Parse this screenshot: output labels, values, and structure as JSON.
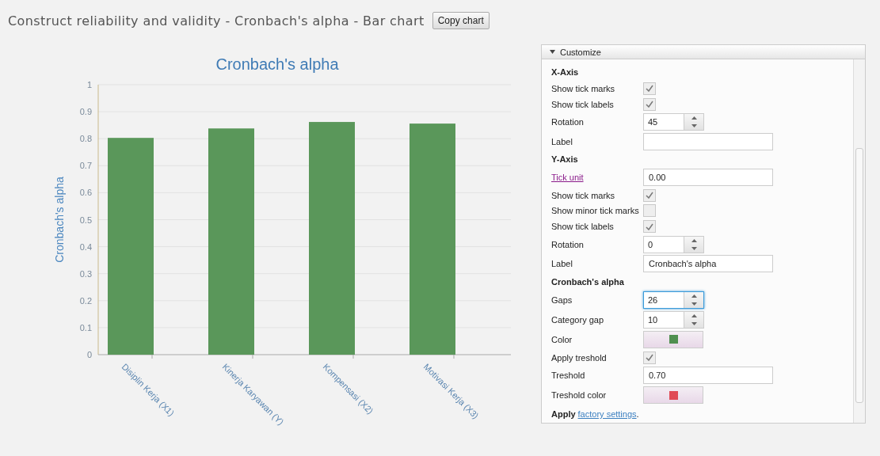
{
  "title": "Construct reliability and validity - Cronbach's alpha - Bar chart",
  "copy_button": "Copy chart",
  "chart_data": {
    "type": "bar",
    "title": "Cronbach's alpha",
    "ylabel": "Cronbach's alpha",
    "categories": [
      "Disiplin Kerja (X1)",
      "Kinerja Karyawan (Y)",
      "Kompensasi (X2)",
      "Motivasi Kerja (X3)"
    ],
    "grid": true,
    "series": [
      {
        "color": "#5a975a",
        "values": [
          0.803,
          0.838,
          0.862,
          0.856
        ]
      }
    ],
    "ylim": [
      0,
      1
    ],
    "yticks": [
      0,
      0.1,
      0.2,
      0.3,
      0.4,
      0.5,
      0.6,
      0.7,
      0.8,
      0.9,
      1
    ]
  },
  "customize": {
    "title": "Customize",
    "expanded": true,
    "rows": [
      {
        "kind": "heading",
        "label": "X-Axis"
      },
      {
        "kind": "checkbox",
        "label": "Show tick marks",
        "checked": true
      },
      {
        "kind": "checkbox",
        "label": "Show tick labels",
        "checked": true
      },
      {
        "kind": "spinner",
        "label": "Rotation",
        "value": "45",
        "focused": false
      },
      {
        "kind": "text",
        "label": "Label",
        "link": false
      },
      {
        "kind": "heading",
        "label": "Y-Axis"
      },
      {
        "kind": "text",
        "label": "Tick unit",
        "value": "0.00",
        "link": true
      },
      {
        "kind": "checkbox",
        "label": "Show tick marks",
        "checked": true
      },
      {
        "kind": "checkbox",
        "label": "Show minor tick marks",
        "checked": false
      },
      {
        "kind": "checkbox",
        "label": "Show tick labels",
        "checked": true
      },
      {
        "kind": "spinner",
        "label": "Rotation",
        "value": "0",
        "focused": false
      },
      {
        "kind": "text",
        "label": "Label",
        "value": "Cronbach's alpha",
        "link": false
      },
      {
        "kind": "heading",
        "label": "Cronbach's alpha"
      },
      {
        "kind": "spinner",
        "label": "Gaps",
        "value": "26",
        "focused": true
      },
      {
        "kind": "spinner",
        "label": "Category gap",
        "value": "10",
        "focused": false
      },
      {
        "kind": "color",
        "label": "Color",
        "color": "#4f8f4f"
      },
      {
        "kind": "checkbox",
        "label": "Apply treshold",
        "checked": true
      },
      {
        "kind": "text",
        "label": "Treshold",
        "value": "0.70",
        "link": false
      },
      {
        "kind": "color",
        "label": "Treshold color",
        "color": "#e04a55"
      }
    ],
    "footer": {
      "prefix": "Apply",
      "link": "factory settings",
      "suffix": "."
    }
  }
}
